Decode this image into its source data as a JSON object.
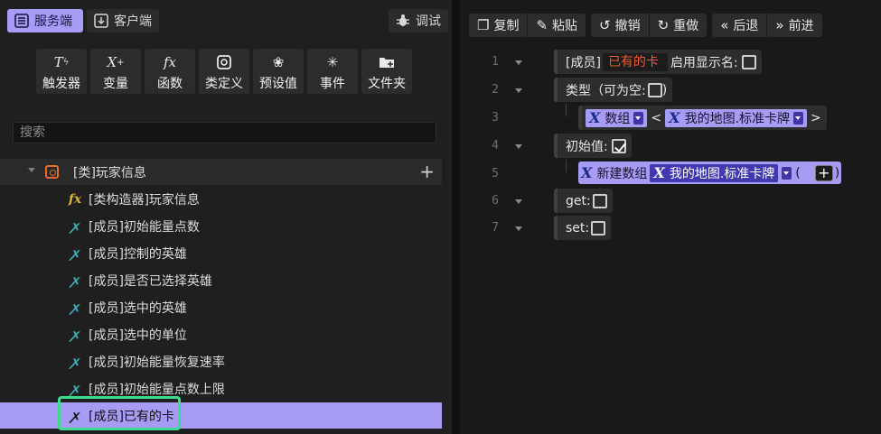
{
  "left_panel": {
    "tabs": {
      "server": "服务端",
      "client": "客户端",
      "debug": "调试"
    },
    "toolbox": [
      {
        "label": "触发器",
        "icon": "trigger-icon",
        "glyph": "T"
      },
      {
        "label": "变量",
        "icon": "variable-add-icon",
        "glyph": "X+"
      },
      {
        "label": "函数",
        "icon": "function-icon",
        "glyph": "fx"
      },
      {
        "label": "类定义",
        "icon": "class-icon",
        "glyph": "◎"
      },
      {
        "label": "预设值",
        "icon": "preset-icon",
        "glyph": "❀"
      },
      {
        "label": "事件",
        "icon": "event-icon",
        "glyph": "✳"
      },
      {
        "label": "文件夹",
        "icon": "folder-add-icon",
        "glyph": "▰"
      }
    ],
    "search": {
      "placeholder": "搜索"
    },
    "tree": {
      "class_label": "[类]玩家信息",
      "items": [
        {
          "label": "[类构造器]玩家信息",
          "icon": "function-icon"
        },
        {
          "label": "[成员]初始能量点数",
          "icon": "variable-icon"
        },
        {
          "label": "[成员]控制的英雄",
          "icon": "variable-icon"
        },
        {
          "label": "[成员]是否已选择英雄",
          "icon": "variable-icon"
        },
        {
          "label": "[成员]选中的英雄",
          "icon": "variable-icon"
        },
        {
          "label": "[成员]选中的单位",
          "icon": "variable-icon"
        },
        {
          "label": "[成员]初始能量恢复速率",
          "icon": "variable-icon"
        },
        {
          "label": "[成员]初始能量点数上限",
          "icon": "variable-icon"
        },
        {
          "label": "[成员]已有的卡",
          "icon": "variable-icon",
          "selected": true
        }
      ]
    }
  },
  "right_panel": {
    "toolbar": {
      "copy": "复制",
      "paste": "粘贴",
      "undo": "撤销",
      "redo": "重做",
      "back": "后退",
      "forward": "前进"
    },
    "lines": [
      "1",
      "2",
      "3",
      "4",
      "5",
      "6",
      "7"
    ],
    "code": {
      "member_prefix": "[成员]",
      "member_name": "已有的卡",
      "show_name_label": "启用显示名:",
      "type_label": "类型（可为空:",
      "type_close": ")",
      "array_label": "数组",
      "lt": "<",
      "gt": ">",
      "map_card": "我的地图.标准卡牌",
      "init_label": "初始值:",
      "new_array": "新建数组",
      "paren_open": "(",
      "paren_close": ")",
      "get_label": "get:",
      "set_label": "set:"
    }
  },
  "colors": {
    "accent": "#a79cf4",
    "highlight_outline": "#3ddc8c",
    "member_name": "#f05a36",
    "class_icon": "#e66b2c",
    "function_icon": "#d8b437",
    "variable_icon": "#3ab3ba"
  }
}
